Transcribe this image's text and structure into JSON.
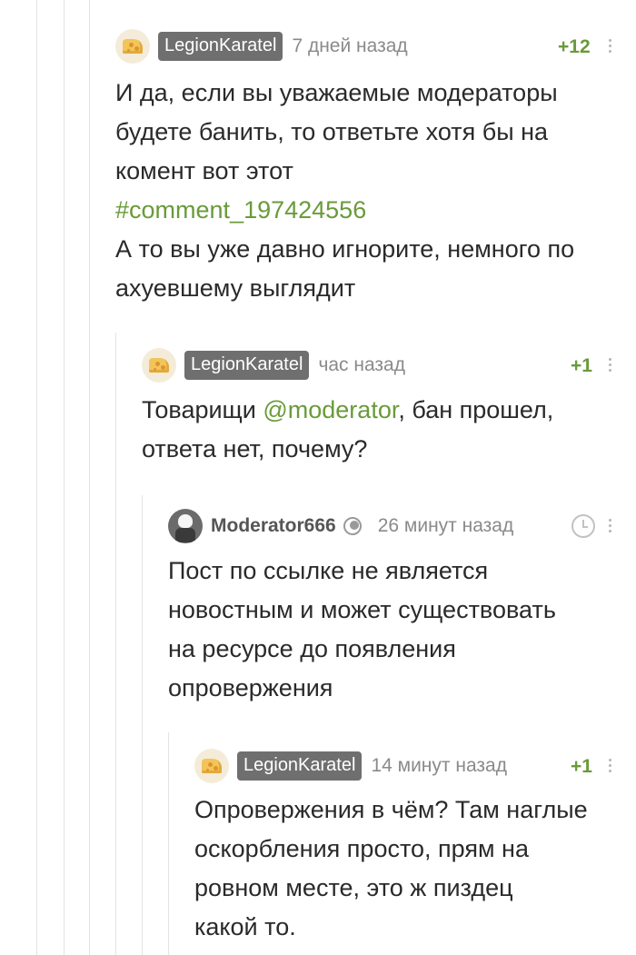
{
  "comments": [
    {
      "user": "LegionKaratel",
      "time": "7 дней назад",
      "rating": "+12",
      "lines": [
        "И да, если вы уважаемые модераторы",
        "будете банить, то ответьте хотя бы на",
        "комент вот этот"
      ],
      "link": "#comment_197424556",
      "after_lines": [
        "А то вы уже давно игнорите, немного по",
        "ахуевшему выглядит"
      ]
    },
    {
      "user": "LegionKaratel",
      "time": "час назад",
      "rating": "+1",
      "text_before": "Товарищи ",
      "mention": "@moderator",
      "text_after": ", бан прошел,",
      "line2": "ответа нет, почему?"
    },
    {
      "user": "Moderator666",
      "time": "26 минут назад",
      "lines": [
        "Пост по ссылке не является",
        "новостным и может существовать",
        "на ресурсе до появления",
        "опровержения"
      ]
    },
    {
      "user": "LegionKaratel",
      "time": "14 минут назад",
      "rating": "+1",
      "lines": [
        "Опровержения в чём? Там наглые",
        "оскорбления просто, прям на",
        "ровном месте, это ж пиздец",
        "какой то."
      ]
    }
  ],
  "colors": {
    "accent_green": "#6a9a3a",
    "badge_bg": "#6f6f6f"
  },
  "icons": [
    "cheese-avatar-icon",
    "moderator-avatar-icon",
    "moderator-badge-icon",
    "clock-icon",
    "more-menu-icon"
  ]
}
